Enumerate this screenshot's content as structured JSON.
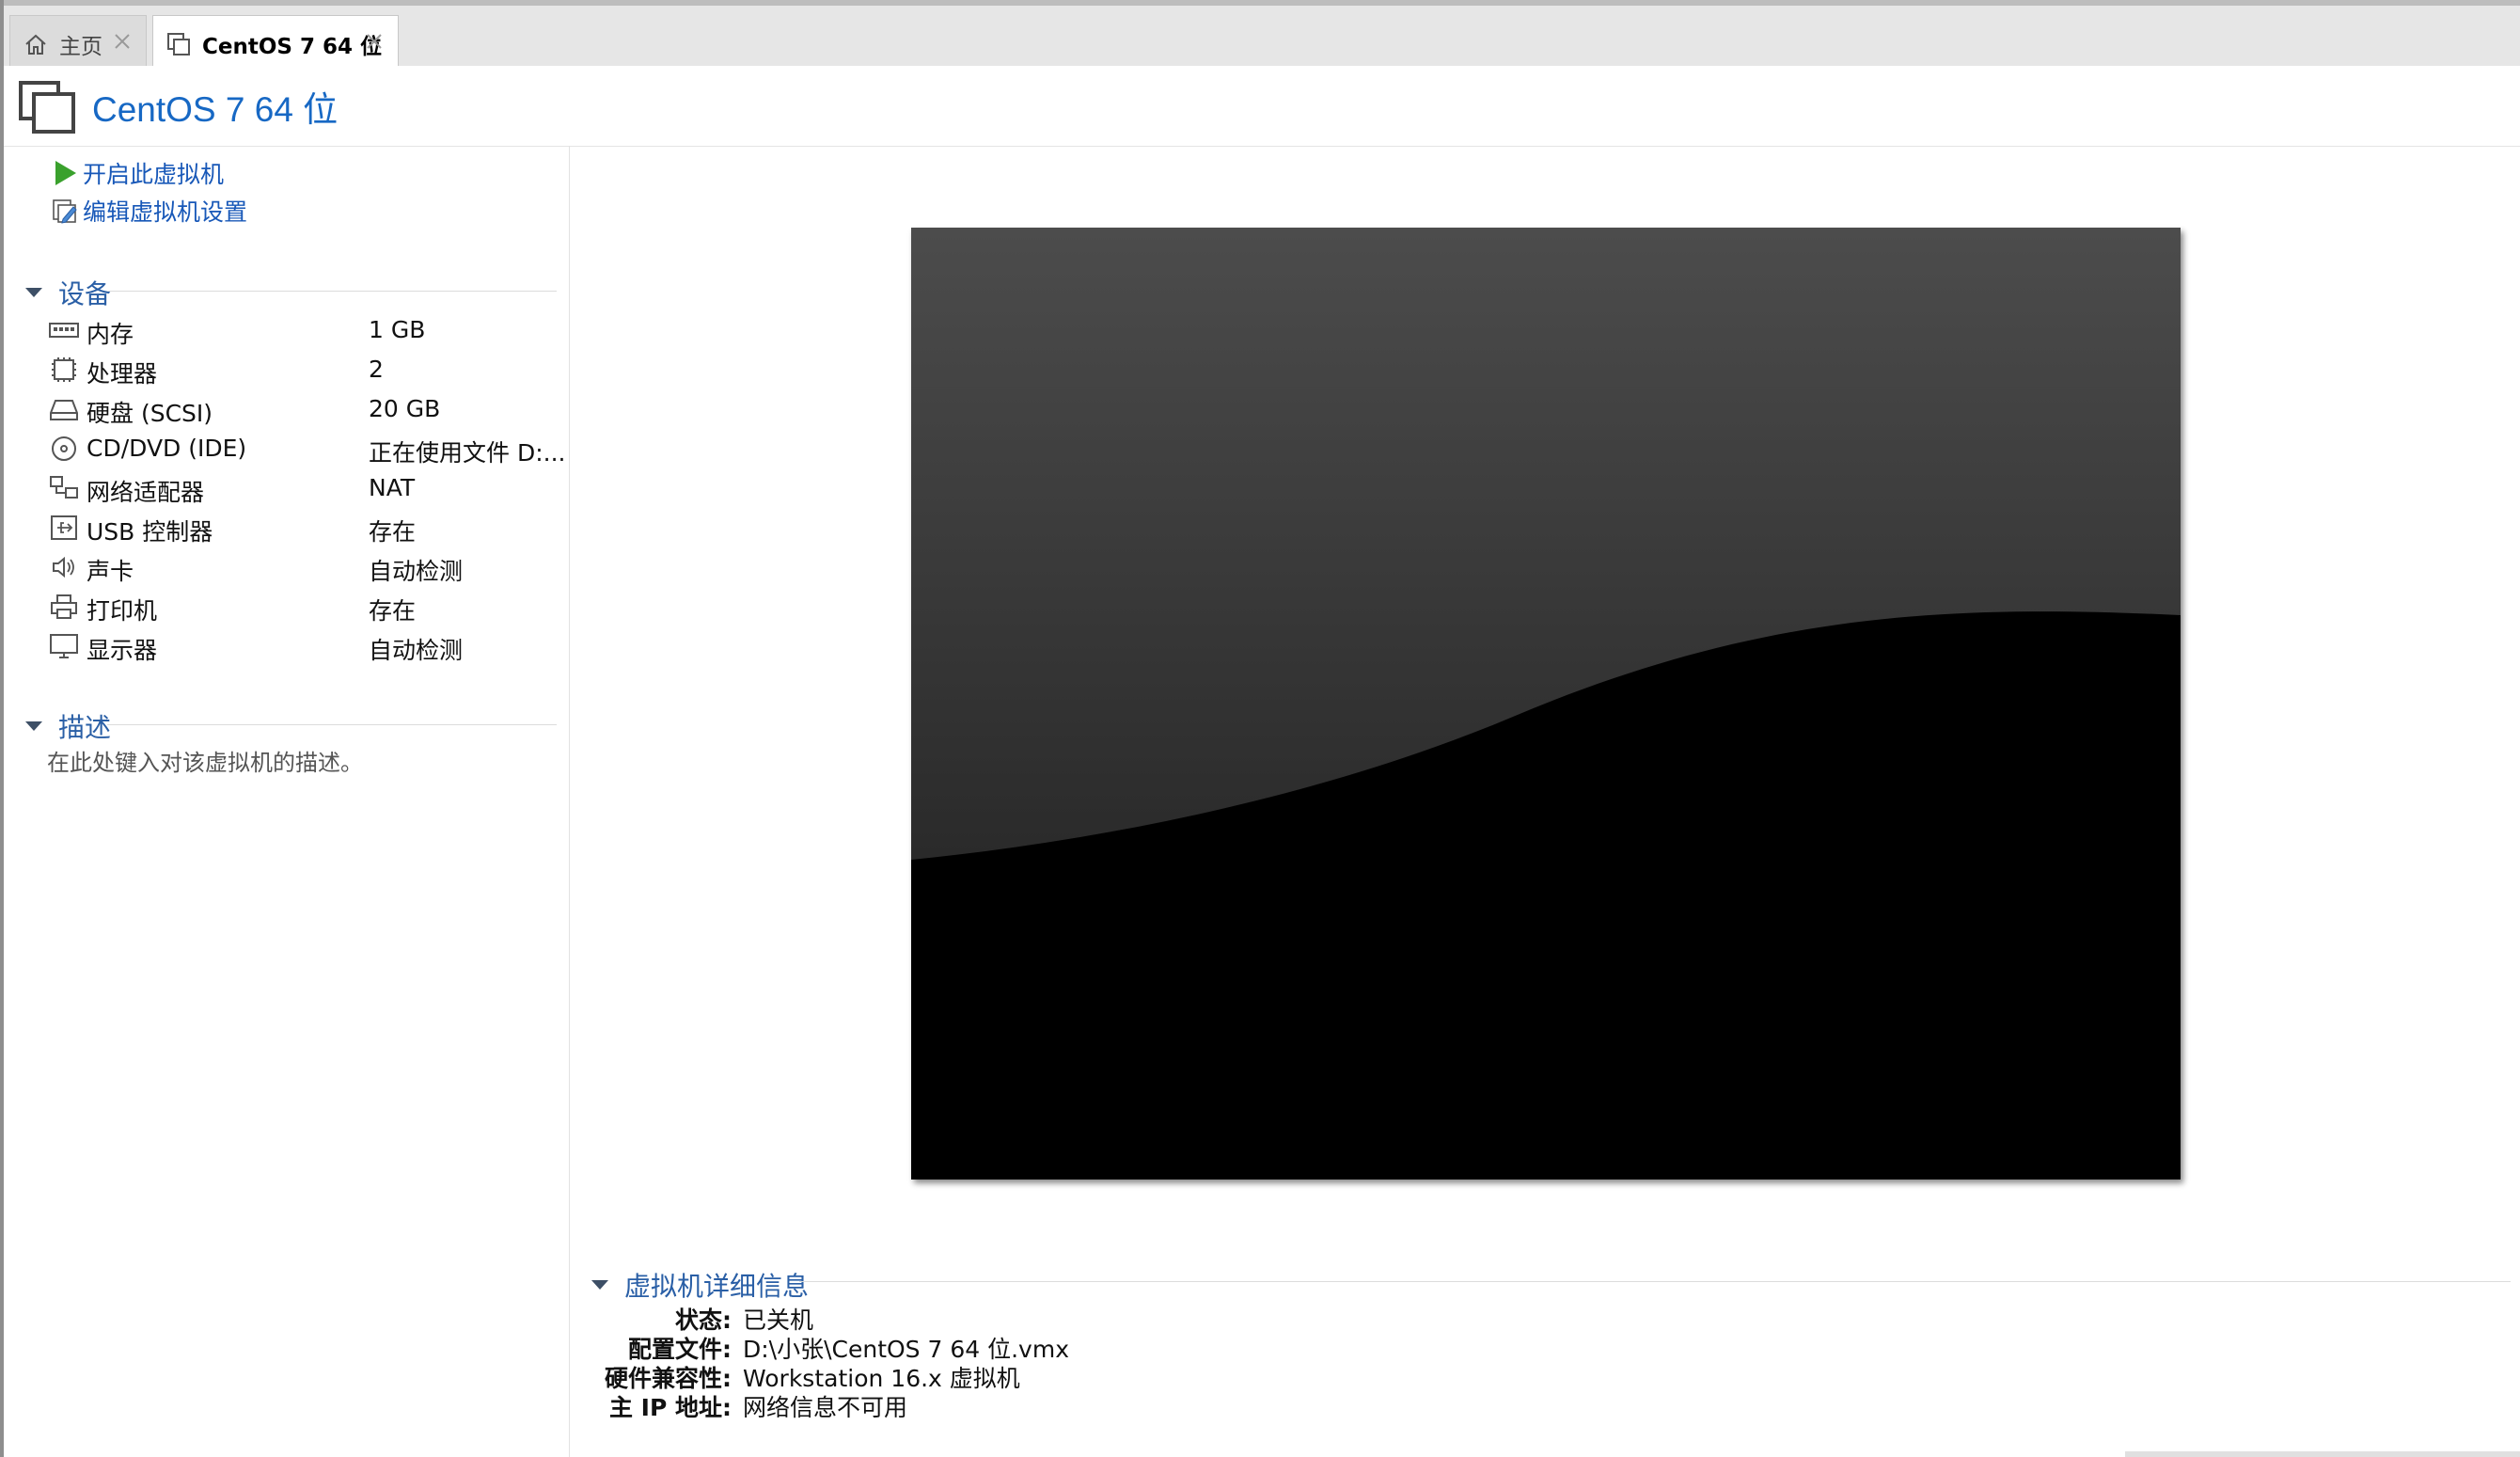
{
  "tabs": [
    {
      "label": "主页",
      "icon": "home-icon",
      "active": false
    },
    {
      "label": "CentOS 7 64 位",
      "icon": "vm-icon",
      "active": true
    }
  ],
  "header": {
    "title": "CentOS 7 64 位"
  },
  "actions": {
    "power_on": "开启此虚拟机",
    "edit_settings": "编辑虚拟机设置"
  },
  "devices": {
    "heading": "设备",
    "items": [
      {
        "name": "内存",
        "value": "1 GB",
        "icon": "memory-icon"
      },
      {
        "name": "处理器",
        "value": "2",
        "icon": "processor-icon"
      },
      {
        "name": "硬盘 (SCSI)",
        "value": "20 GB",
        "icon": "hard-disk-icon"
      },
      {
        "name": "CD/DVD (IDE)",
        "value": "正在使用文件 D:...",
        "icon": "cd-dvd-icon"
      },
      {
        "name": "网络适配器",
        "value": "NAT",
        "icon": "network-adapter-icon"
      },
      {
        "name": "USB 控制器",
        "value": "存在",
        "icon": "usb-icon"
      },
      {
        "name": "声卡",
        "value": "自动检测",
        "icon": "speaker-icon"
      },
      {
        "name": "打印机",
        "value": "存在",
        "icon": "printer-icon"
      },
      {
        "name": "显示器",
        "value": "自动检测",
        "icon": "monitor-icon"
      }
    ]
  },
  "description": {
    "heading": "描述",
    "placeholder": "在此处键入对该虚拟机的描述。"
  },
  "details": {
    "heading": "虚拟机详细信息",
    "rows": [
      {
        "label": "状态:",
        "value": "已关机"
      },
      {
        "label": "配置文件:",
        "value": "D:\\小张\\CentOS 7 64 位.vmx"
      },
      {
        "label": "硬件兼容性:",
        "value": "Workstation 16.x 虚拟机"
      },
      {
        "label": "主 IP 地址:",
        "value": "网络信息不可用"
      }
    ]
  },
  "colors": {
    "link_blue": "#1858b8",
    "title_blue": "#1768c4",
    "section_blue": "#2a5fa6",
    "play_green": "#3aa12d"
  }
}
